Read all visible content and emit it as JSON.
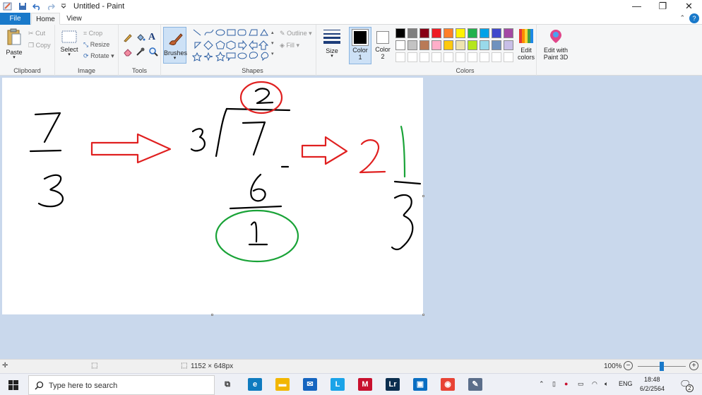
{
  "window": {
    "title": "Untitled - Paint",
    "minimize_glyph": "—",
    "restore_glyph": "❐",
    "close_glyph": "✕"
  },
  "tabs": {
    "file": "File",
    "home": "Home",
    "view": "View",
    "help_glyph": "?",
    "collapse_glyph": "⌃"
  },
  "ribbon": {
    "clipboard": {
      "label": "Clipboard",
      "paste": "Paste",
      "cut": "Cut",
      "copy": "Copy"
    },
    "image": {
      "label": "Image",
      "select": "Select",
      "crop": "Crop",
      "resize": "Resize",
      "rotate": "Rotate"
    },
    "tools": {
      "label": "Tools",
      "text_glyph": "A"
    },
    "brushes": {
      "label": "Brushes"
    },
    "shapes": {
      "label": "Shapes",
      "outline": "Outline",
      "fill": "Fill"
    },
    "size": {
      "label": "Size"
    },
    "color1": {
      "label": "Color",
      "sub": "1",
      "value": "#000000"
    },
    "color2": {
      "label": "Color",
      "sub": "2",
      "value": "#ffffff"
    },
    "colors": {
      "label": "Colors",
      "edit_label_1": "Edit",
      "edit_label_2": "colors",
      "palette_row1": [
        "#000000",
        "#7f7f7f",
        "#880015",
        "#ed1c24",
        "#ff7f27",
        "#fff200",
        "#22b14c",
        "#00a2e8",
        "#3f48cc",
        "#a349a4"
      ],
      "palette_row2": [
        "#ffffff",
        "#c3c3c3",
        "#b97a57",
        "#ffaec9",
        "#ffc90e",
        "#efe4b0",
        "#b5e61d",
        "#99d9ea",
        "#7092be",
        "#c8bfe7"
      ]
    },
    "paint3d": {
      "label_1": "Edit with",
      "label_2": "Paint 3D"
    }
  },
  "canvas": {
    "background": "#ffffff",
    "ink_black": "#000000",
    "ink_red": "#e02020",
    "ink_green": "#1aa338"
  },
  "statusbar": {
    "dimensions": "1152 × 648px",
    "zoom": "100%",
    "zoom_minus": "−",
    "zoom_plus": "+"
  },
  "taskbar": {
    "search_placeholder": "Type here to search",
    "lang": "ENG",
    "time": "18:48",
    "date": "6/2/2564",
    "notifications": "2",
    "apps": [
      {
        "name": "task-view",
        "glyph": "⧉",
        "color": "#333333"
      },
      {
        "name": "edge",
        "glyph": "e",
        "color": "#0f7bbf"
      },
      {
        "name": "file-explorer",
        "glyph": "▬",
        "color": "#f2b600"
      },
      {
        "name": "mail",
        "glyph": "✉",
        "color": "#1565c0"
      },
      {
        "name": "l-app",
        "glyph": "L",
        "color": "#1aa3e8"
      },
      {
        "name": "mcafee",
        "glyph": "M",
        "color": "#c8102e"
      },
      {
        "name": "lightroom",
        "glyph": "Lr",
        "color": "#0b2e4f"
      },
      {
        "name": "store",
        "glyph": "▣",
        "color": "#0a6ec2"
      },
      {
        "name": "chrome",
        "glyph": "◉",
        "color": "#e84335"
      },
      {
        "name": "paint",
        "glyph": "✎",
        "color": "#5b6e8a"
      }
    ]
  }
}
